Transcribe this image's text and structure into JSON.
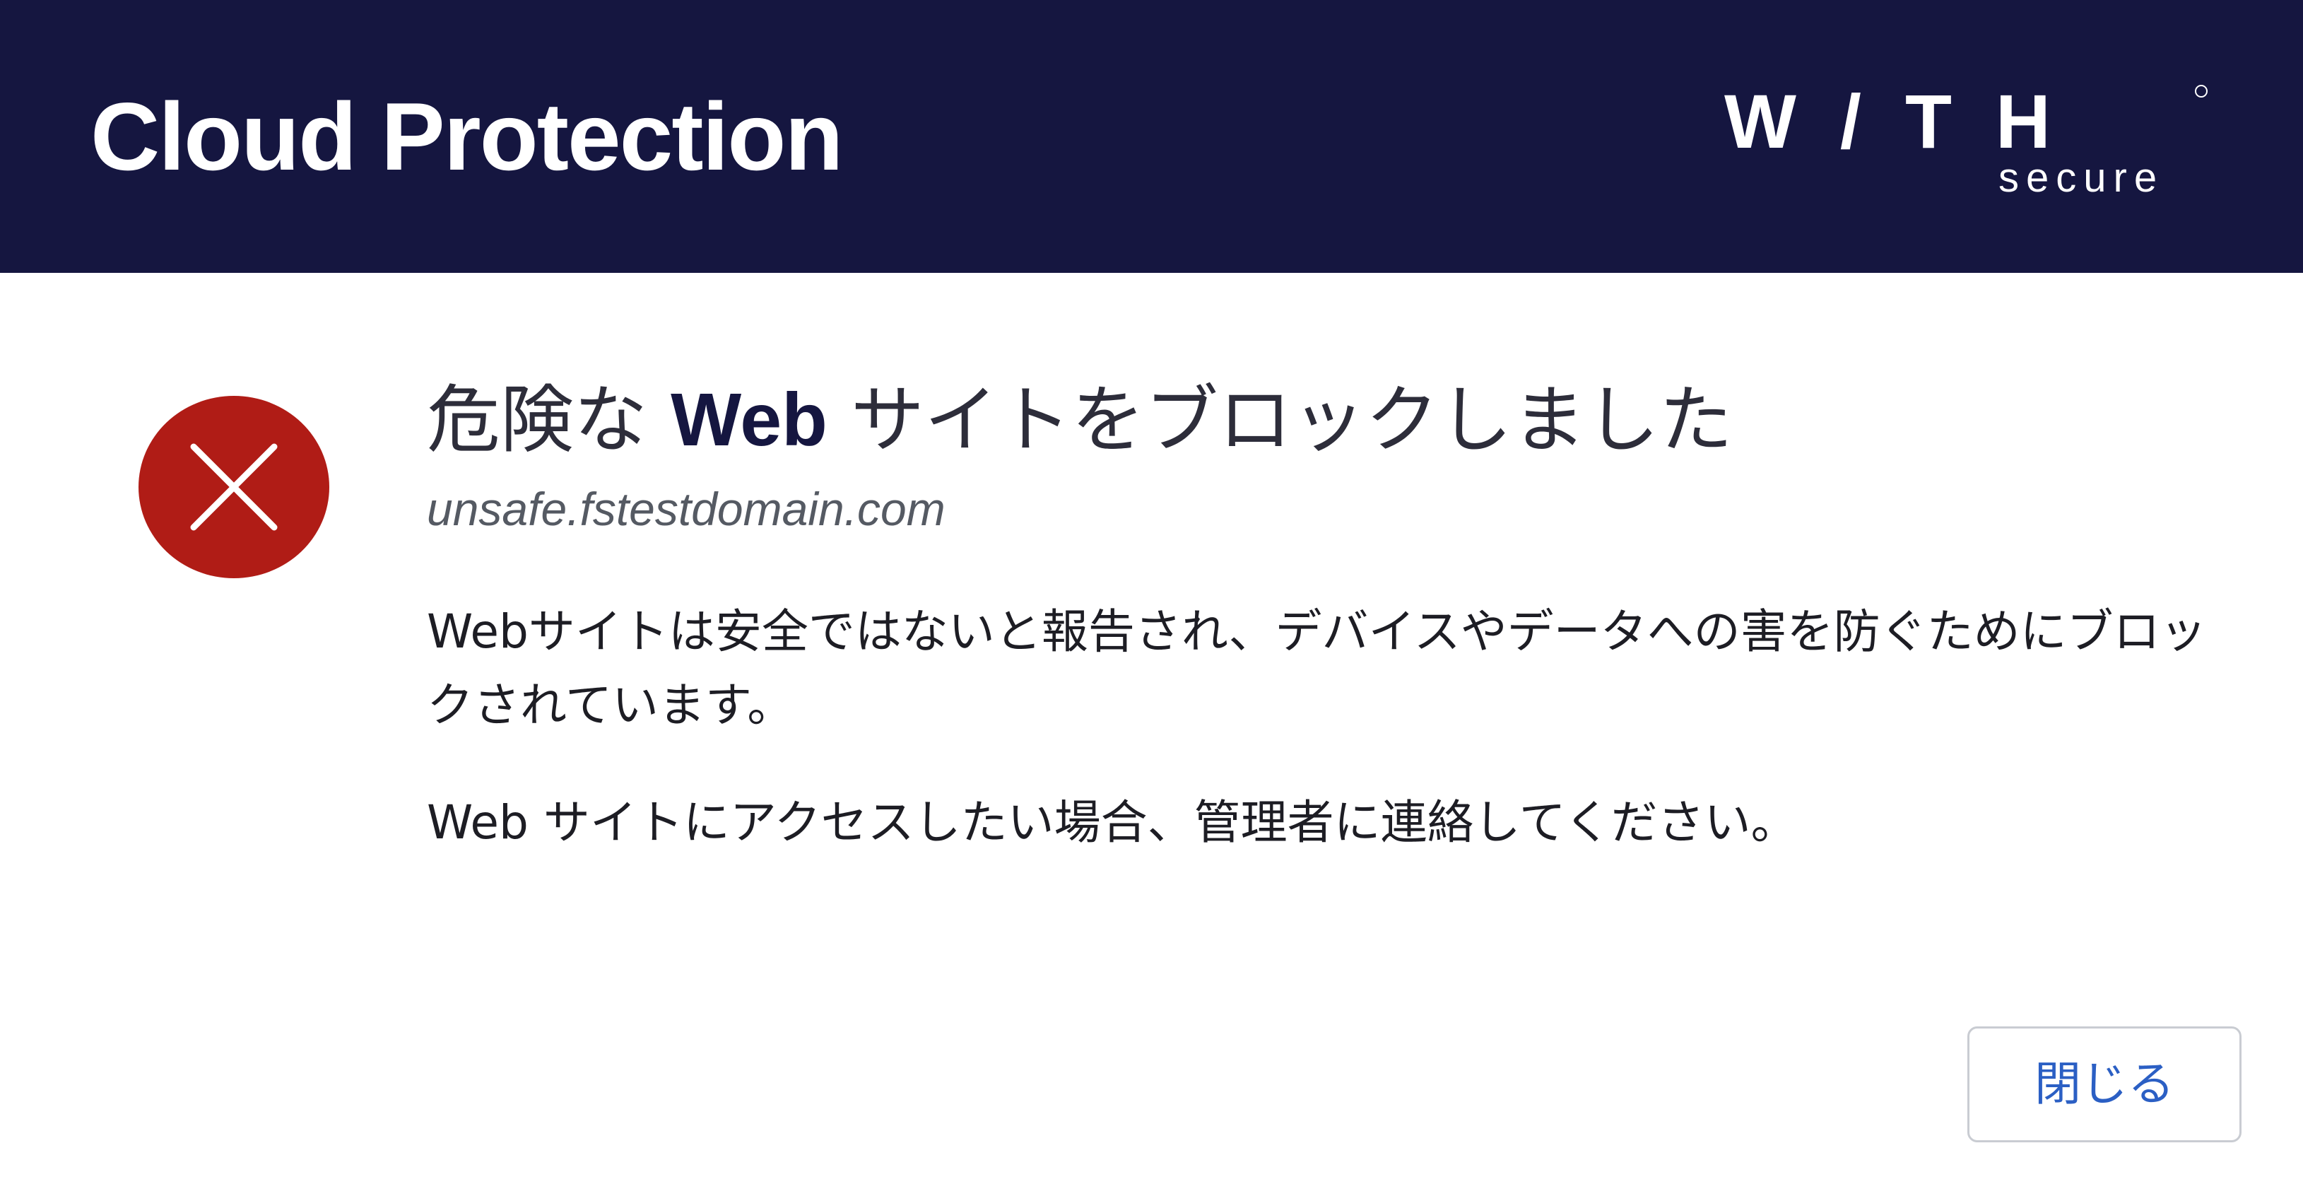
{
  "header": {
    "title": "Cloud Protection",
    "logo_word": "W/TH",
    "logo_sub": "secure"
  },
  "icons": {
    "status": "error-x-circle-icon"
  },
  "colors": {
    "header_bg": "#151640",
    "error_red": "#b01c16",
    "button_text": "#2b5fc4"
  },
  "main": {
    "title_prefix": "危険な ",
    "title_bold": "Web",
    "title_suffix": " サイトをブロックしました",
    "domain": "unsafe.fstestdomain.com",
    "description": "Webサイトは安全ではないと報告され、デバイスやデータへの害を防ぐためにブロックされています。",
    "contact": "Web サイトにアクセスしたい場合、管理者に連絡してください。"
  },
  "actions": {
    "close_label": "閉じる"
  }
}
